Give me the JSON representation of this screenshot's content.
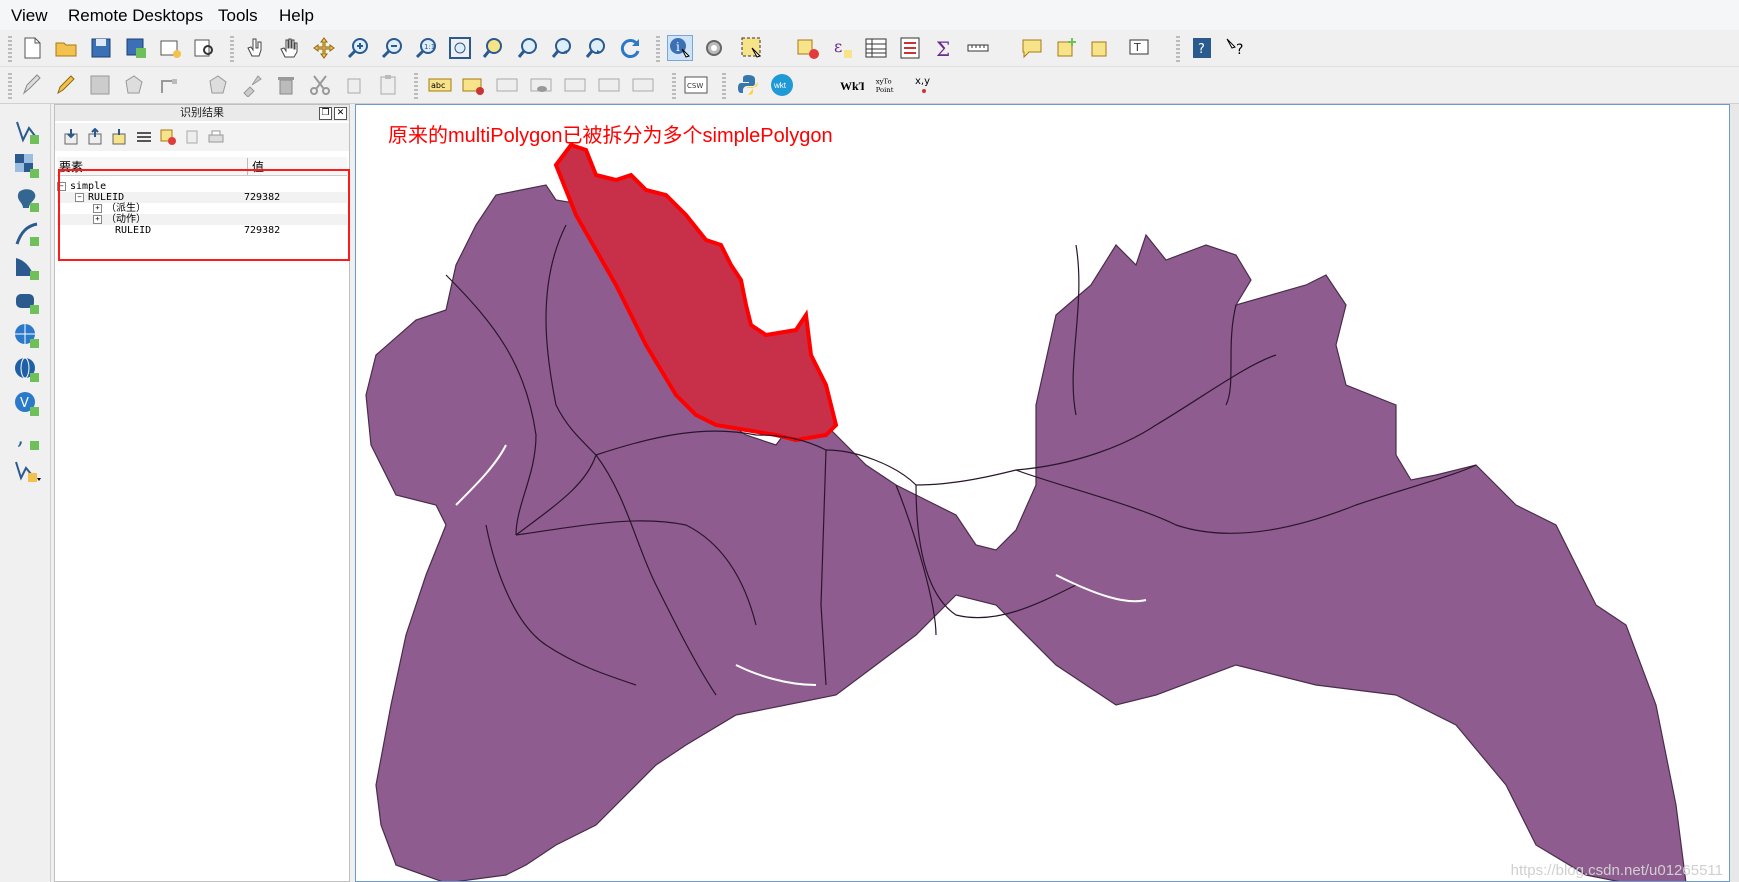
{
  "menu": {
    "items": [
      "View",
      "Remote Desktops",
      "Tools",
      "Help"
    ]
  },
  "identify_panel": {
    "title": "识别结果",
    "columns": [
      "要素",
      "值"
    ],
    "rows": [
      {
        "label": "simple",
        "value": ""
      },
      {
        "label": "RULEID",
        "value": "729382"
      },
      {
        "label": "（派生）",
        "value": ""
      },
      {
        "label": "（动作）",
        "value": ""
      },
      {
        "label": "RULEID",
        "value": "729382"
      }
    ]
  },
  "toolbar": {
    "wkt_label": "wkt",
    "csw_label": "CSW",
    "xyto_label": "xyTo",
    "point_label": "Point",
    "xy_label": "x,y",
    "wk_label": "WkT",
    "abc_label": "abc"
  },
  "map": {
    "annotation": "原来的multiPolygon已被拆分为多个simplePolygon",
    "watermark": "https://blog.csdn.net/u01265511",
    "polygon_fill": "#8e5c8f",
    "selected_fill": "#c8304a",
    "selected_stroke": "#ff0000"
  }
}
